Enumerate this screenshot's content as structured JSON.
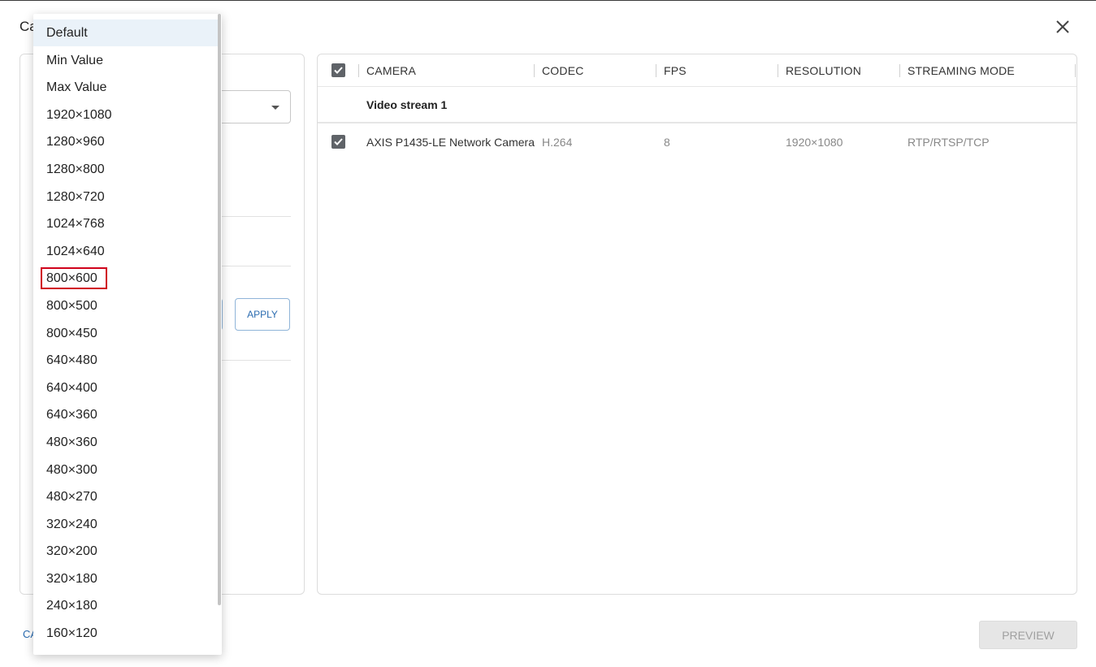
{
  "dialog": {
    "title_partial": "Ca",
    "footer_link_partial": "CA",
    "preview_label": "PREVIEW"
  },
  "left_panel": {
    "apply_label": "APPLY"
  },
  "table": {
    "headers": [
      "CAMERA",
      "CODEC",
      "FPS",
      "RESOLUTION",
      "STREAMING MODE"
    ],
    "group_label": "Video stream 1",
    "rows": [
      {
        "camera": "AXIS P1435-LE Network Camera",
        "codec": "H.264",
        "fps": "8",
        "resolution": "1920×1080",
        "streaming_mode": "RTP/RTSP/TCP"
      }
    ]
  },
  "dropdown": {
    "selected": "Default",
    "highlighted": "800×600",
    "options": [
      "Default",
      "Min Value",
      "Max Value",
      "1920×1080",
      "1280×960",
      "1280×800",
      "1280×720",
      "1024×768",
      "1024×640",
      "800×600",
      "800×500",
      "800×450",
      "640×480",
      "640×400",
      "640×360",
      "480×360",
      "480×300",
      "480×270",
      "320×240",
      "320×200",
      "320×180",
      "240×180",
      "160×120"
    ]
  }
}
